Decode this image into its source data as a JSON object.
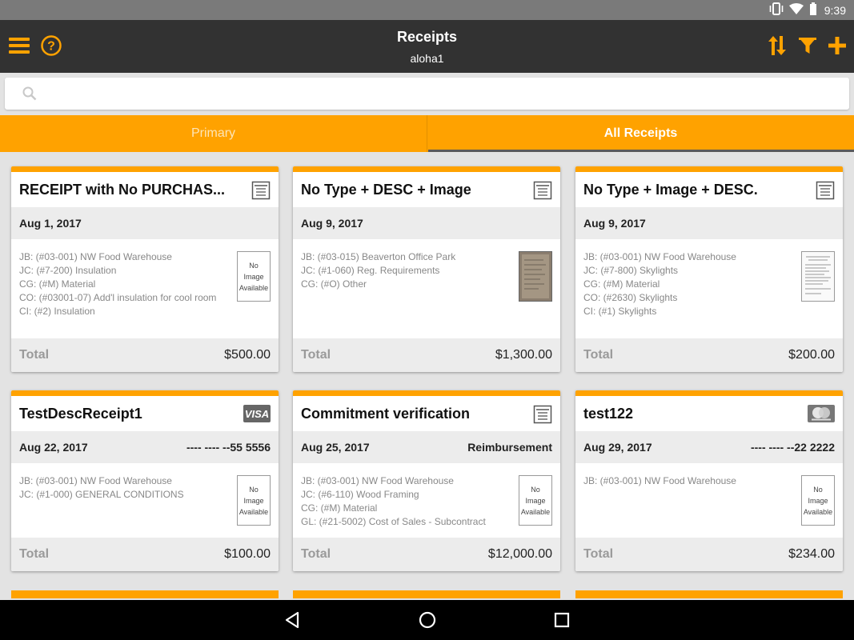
{
  "status_bar": {
    "time": "9:39"
  },
  "app_bar": {
    "title": "Receipts",
    "subtitle": "aloha1"
  },
  "search": {
    "placeholder": ""
  },
  "tabs": [
    {
      "label": "Primary",
      "active": false
    },
    {
      "label": "All Receipts",
      "active": true
    }
  ],
  "total_label": "Total",
  "no_image": {
    "l1": "No",
    "l2": "Image",
    "l3": "Available"
  },
  "cards": [
    {
      "title": "RECEIPT with No PURCHAS...",
      "date": "Aug 1, 2017",
      "right_info": "",
      "type_icon": "receipt-icon",
      "lines": [
        "JB: (#03-001) NW Food Warehouse",
        "JC: (#7-200) Insulation",
        "CG: (#M) Material",
        "CO: (#03001-07) Add'l insulation for cool room",
        "CI: (#2) Insulation"
      ],
      "thumb": "no-image",
      "total": "$500.00"
    },
    {
      "title": "No Type + DESC + Image",
      "date": "Aug 9, 2017",
      "right_info": "",
      "type_icon": "receipt-icon",
      "lines": [
        "JB: (#03-015) Beaverton Office Park",
        "JC: (#1-060) Reg. Requirements",
        "CG: (#O) Other"
      ],
      "thumb": "photo-dark",
      "total": "$1,300.00"
    },
    {
      "title": "No Type + Image + DESC.",
      "date": "Aug 9, 2017",
      "right_info": "",
      "type_icon": "receipt-icon",
      "lines": [
        "JB: (#03-001) NW Food Warehouse",
        "JC: (#7-800) Skylights",
        "CG: (#M) Material",
        "CO: (#2630) Skylights",
        "CI: (#1) Skylights"
      ],
      "thumb": "photo-light",
      "total": "$200.00"
    },
    {
      "title": "TestDescReceipt1",
      "date": "Aug 22, 2017",
      "right_info": "---- ---- --55 5556",
      "type_icon": "visa-card-icon",
      "lines": [
        "JB: (#03-001) NW Food Warehouse",
        "JC: (#1-000) GENERAL CONDITIONS"
      ],
      "thumb": "no-image",
      "total": "$100.00"
    },
    {
      "title": "Commitment verification",
      "date": "Aug 25, 2017",
      "right_info": "Reimbursement",
      "type_icon": "receipt-icon",
      "lines": [
        "JB: (#03-001) NW Food Warehouse",
        "JC: (#6-110) Wood Framing",
        "CG: (#M) Material",
        "GL: (#21-5002) Cost of Sales - Subcontract"
      ],
      "thumb": "no-image",
      "total": "$12,000.00"
    },
    {
      "title": "test122",
      "date": "Aug 29, 2017",
      "right_info": "---- ---- --22 2222",
      "type_icon": "mastercard-icon",
      "lines": [
        "JB: (#03-001) NW Food Warehouse"
      ],
      "thumb": "no-image",
      "total": "$234.00"
    }
  ],
  "colors": {
    "accent": "#ffa200",
    "appbar": "#323232",
    "statusbar": "#7a7a7a"
  }
}
